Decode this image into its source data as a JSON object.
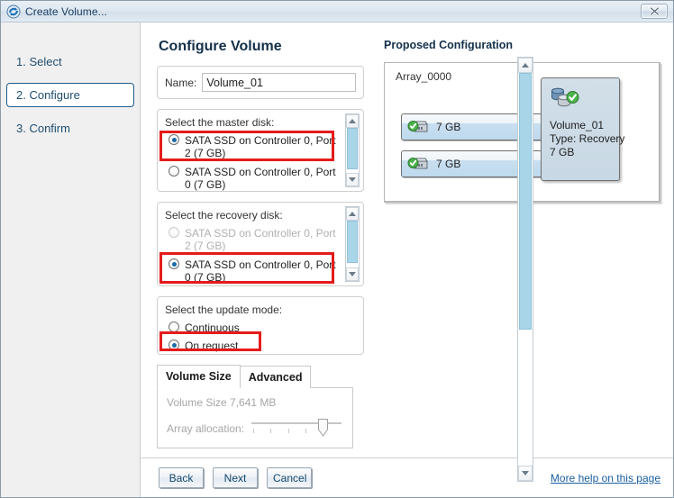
{
  "window": {
    "title": "Create Volume...",
    "title_icon": "create-volume-icon",
    "close_label": "✕"
  },
  "sidebar": {
    "steps": [
      {
        "label": "1. Select",
        "current": false
      },
      {
        "label": "2. Configure",
        "current": true
      },
      {
        "label": "3. Confirm",
        "current": false
      }
    ]
  },
  "configure": {
    "page_title": "Configure Volume",
    "name": {
      "label": "Name:",
      "value": "Volume_01"
    },
    "master_disk": {
      "label": "Select the master disk:",
      "options": [
        {
          "label": "SATA SSD on Controller 0, Port 2 (7 GB)",
          "selected": true,
          "disabled": false,
          "highlighted": true
        },
        {
          "label": "SATA SSD on Controller 0, Port 0 (7 GB)",
          "selected": false,
          "disabled": false,
          "highlighted": false
        }
      ]
    },
    "recovery_disk": {
      "label": "Select the recovery disk:",
      "options": [
        {
          "label": "SATA SSD on Controller 0, Port 2 (7 GB)",
          "selected": false,
          "disabled": true,
          "highlighted": false
        },
        {
          "label": "SATA SSD on Controller 0, Port 0 (7 GB)",
          "selected": true,
          "disabled": false,
          "highlighted": true
        }
      ]
    },
    "update_mode": {
      "label": "Select the update mode:",
      "options": [
        {
          "label": "Continuous",
          "selected": false,
          "highlighted": false
        },
        {
          "label": "On request",
          "selected": true,
          "highlighted": true
        }
      ]
    },
    "tabs": [
      {
        "label": "Volume Size",
        "active": true
      },
      {
        "label": "Advanced",
        "active": false
      }
    ],
    "volume_size_panel": {
      "size_text": "Volume Size 7,641 MB",
      "allocation_label": "Array allocation:",
      "allocation_percent": 73
    }
  },
  "proposed": {
    "title": "Proposed Configuration",
    "array_label": "Array_0000",
    "disks": [
      {
        "size": "7 GB",
        "icon": "disk-ok-icon"
      },
      {
        "size": "7 GB",
        "icon": "disk-ok-icon"
      }
    ],
    "volume": {
      "icon": "volume-ok-icon",
      "name": "Volume_01",
      "type": "Type: Recovery",
      "size": "7 GB"
    }
  },
  "footer": {
    "buttons": [
      {
        "label": "Back"
      },
      {
        "label": "Next"
      },
      {
        "label": "Cancel"
      }
    ],
    "help_link": "More help on this page"
  },
  "colors": {
    "accent": "#1a6aa8",
    "highlight": "#e51b1b",
    "scrollbar_thumb": "#a9d5e8",
    "title_text": "#1b3f63"
  }
}
